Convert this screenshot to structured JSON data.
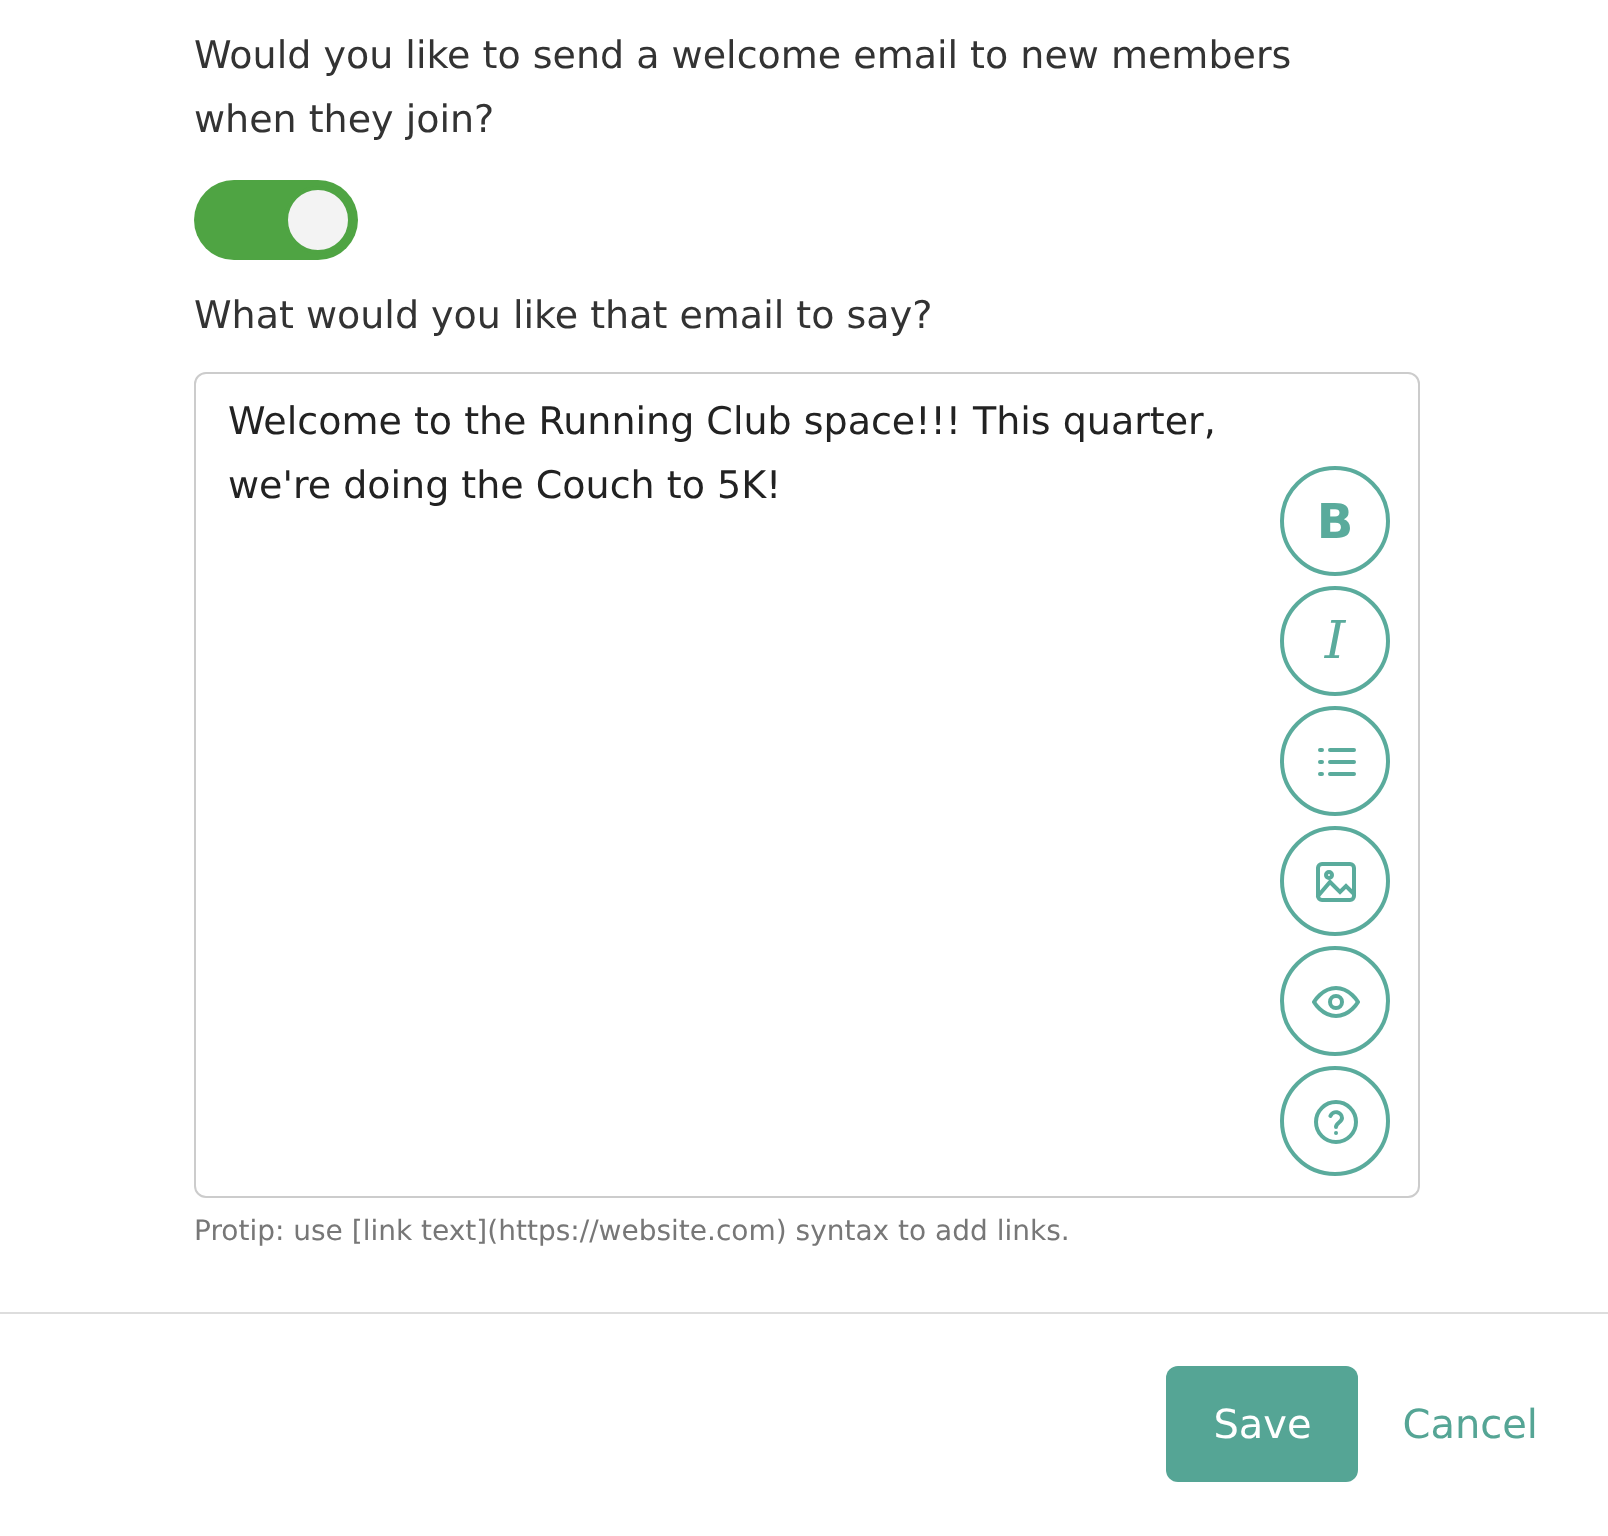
{
  "question": "Would you like to send a welcome email to new members when they join?",
  "toggle": {
    "on": true
  },
  "message_label": "What would you like that email to say?",
  "message": {
    "value": "Welcome to the Running Club space!!! This quarter, we're doing the Couch to 5K!"
  },
  "toolbar": [
    {
      "kind": "bold",
      "glyph": "B"
    },
    {
      "kind": "italic",
      "glyph": "I"
    },
    {
      "kind": "list"
    },
    {
      "kind": "image"
    },
    {
      "kind": "preview"
    },
    {
      "kind": "help"
    }
  ],
  "protip": "Protip: use [link text](https://website.com) syntax to add links.",
  "buttons": {
    "save": "Save",
    "cancel": "Cancel"
  }
}
